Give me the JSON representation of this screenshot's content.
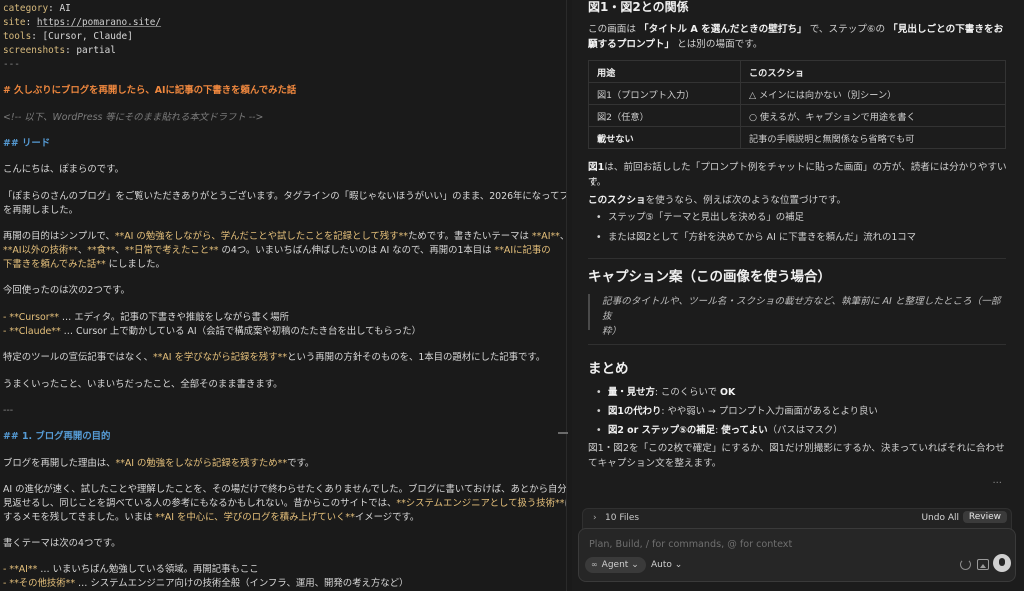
{
  "editor": {
    "frontmatter": {
      "category_key": "category",
      "category_val": "AI",
      "site_key": "site",
      "site_val": "https://pomarano.site/",
      "tools_key": "tools",
      "tools_val": "[Cursor, Claude]",
      "screenshots_key": "screenshots",
      "screenshots_val": "partial",
      "close": "---"
    },
    "title": "# 久しぶりにブログを再開したら、AIに記事の下書きを頼んでみた話",
    "comment": "<!-- 以下、WordPress 等にそのまま貼れる本文ドラフト -->",
    "lead_heading": "## リード",
    "p1": "こんにちは、ぽまらのです。",
    "p2a": "「ぽまらのさんのブログ」をご覧いただきありがとうございます。タグラインの「暇じゃないほうがいい」のまま、2026年になってブログ",
    "p2b": "を再開しました。",
    "p3a_1": "再開の目的はシンプルで、",
    "p3a_2": "**AI の勉強をしながら、学んだことや試したことを記録として残す**",
    "p3a_3": "ためです。書きたいテーマは ",
    "p3a_4": "**AI**",
    "p3a_5": "、",
    "p3b_1": "**AI以外の技術**",
    "p3b_2": "、",
    "p3b_3": "**食**",
    "p3b_4": "、",
    "p3b_5": "**日常で考えたこと**",
    "p3b_6": " の4つ。いまいちばん伸ばしたいのは AI なので、再開の1本目は ",
    "p3b_7": "**AIに記事の",
    "p3c_1": "下書きを頼んでみた話**",
    "p3c_2": " にしました。",
    "p4": "今回使ったのは次の2つです。",
    "li1_a": "- ",
    "li1_b": "**Cursor**",
    "li1_c": " … エディタ。記事の下書きや推敲をしながら書く場所",
    "li2_a": "- ",
    "li2_b": "**Claude**",
    "li2_c": " … Cursor 上で動かしている AI（会話で構成案や初稿のたたき台を出してもらった）",
    "p5_1": "特定のツールの宣伝記事ではなく、",
    "p5_2": "**AI を学びながら記録を残す**",
    "p5_3": "という再開の方針そのものを、1本目の題材にした記事です。",
    "p6": "うまくいったこと、いまいちだったこと、全部そのまま書きます。",
    "hr": "---",
    "sec1_heading": "## 1. ブログ再開の目的",
    "p7_1": "ブログを再開した理由は、",
    "p7_2": "**AI の勉強をしながら記録を残すため**",
    "p7_3": "です。",
    "p8a": "AI の進化が速く、試したことや理解したことを、その場だけで終わらせたくありませんでした。ブログに書いておけば、あとから自分が",
    "p8b_1": "見返せるし、同じことを調べている人の参考にもなるかもしれない。昔からこのサイトでは、",
    "p8b_2": "**システムエンジニアとして扱う技術**",
    "p8b_3": "に関",
    "p8c_1": "するメモを残してきました。いまは ",
    "p8c_2": "**AI を中心に、学びのログを積み上げていく**",
    "p8c_3": "イメージです。",
    "p9": "書くテーマは次の4つです。",
    "li3_a": "- ",
    "li3_b": "**AI**",
    "li3_c": " … いまいちばん勉強している領域。再開記事もここ",
    "li4_a": "- ",
    "li4_b": "**その他技術**",
    "li4_c": " … システムエンジニア向けの技術全般（インフラ、運用、開発の考え方など）"
  },
  "panel": {
    "heading_top": "図1・図2との関係",
    "intro_1": "この画面は",
    "intro_2": "「タイトル A を選んだときの壁打ち」",
    "intro_3": "で、ステップ⑥の",
    "intro_4": "「見出しごとの下書きをお願",
    "intro_5": "いするプロンプト」",
    "intro_6": "とは別の場面です。",
    "table": {
      "headers": [
        "用途",
        "このスクショ"
      ],
      "rows": [
        [
          "図1（プロンプト入力）",
          "△ メインには向かない（別シーン）"
        ],
        [
          "図2（任意）",
          "○ 使えるが、キャプションで用途を書く"
        ],
        [
          "載せない",
          "記事の手順説明と無関係なら省略でも可"
        ]
      ]
    },
    "p_fig1_a_bold": "図1",
    "p_fig1_a": "は、前回お話しした「プロンプト例をチャットに貼った画面」の方が、読者には分かりやすいで",
    "p_fig1_b": "す。",
    "p_use_bold": "このスクショ",
    "p_use": "を使うなら、例えば次のような位置づけです。",
    "bullets_use": [
      "ステップ⑤「テーマと見出しを決める」の補足",
      "または図2として「方針を決めてから AI に下書きを頼んだ」流れの1コマ"
    ],
    "caption_heading": "キャプション案（この画像を使う場合）",
    "quote_1": "記事のタイトルや、ツール名・スクショの載せ方など、執筆前に AI と整理したところ（一部抜",
    "quote_2": "粋）",
    "summary_heading": "まとめ",
    "sum1_bold": "量・見せ方",
    "sum1_rest": ": このくらいで ",
    "sum1_ok": "OK",
    "sum2_bold": "図1の代わり",
    "sum2_rest": ": やや弱い → プロンプト入力画面があるとより良い",
    "sum3_bold": "図2 or ステップ⑤の補足",
    "sum3_rest": ": ",
    "sum3_bold2": "使ってよい",
    "sum3_tail": "（パスはマスク）",
    "closing_1": "図1・図2を「この2枚で確定」にするか、図1だけ別撮影にするか、決まっていればそれに合わせ",
    "closing_2": "てキャプション文を整えます。",
    "ellipsis": "···",
    "files_chevron": "›",
    "files_count": "10 Files",
    "undo_all": "Undo All",
    "review": "Review",
    "composer_placeholder": "Plan, Build, / for commands, @ for context",
    "agent_icon": "∞",
    "agent_label": "Agent",
    "agent_chevron": "⌄",
    "model_label": "Auto",
    "model_chevron": "⌄"
  }
}
